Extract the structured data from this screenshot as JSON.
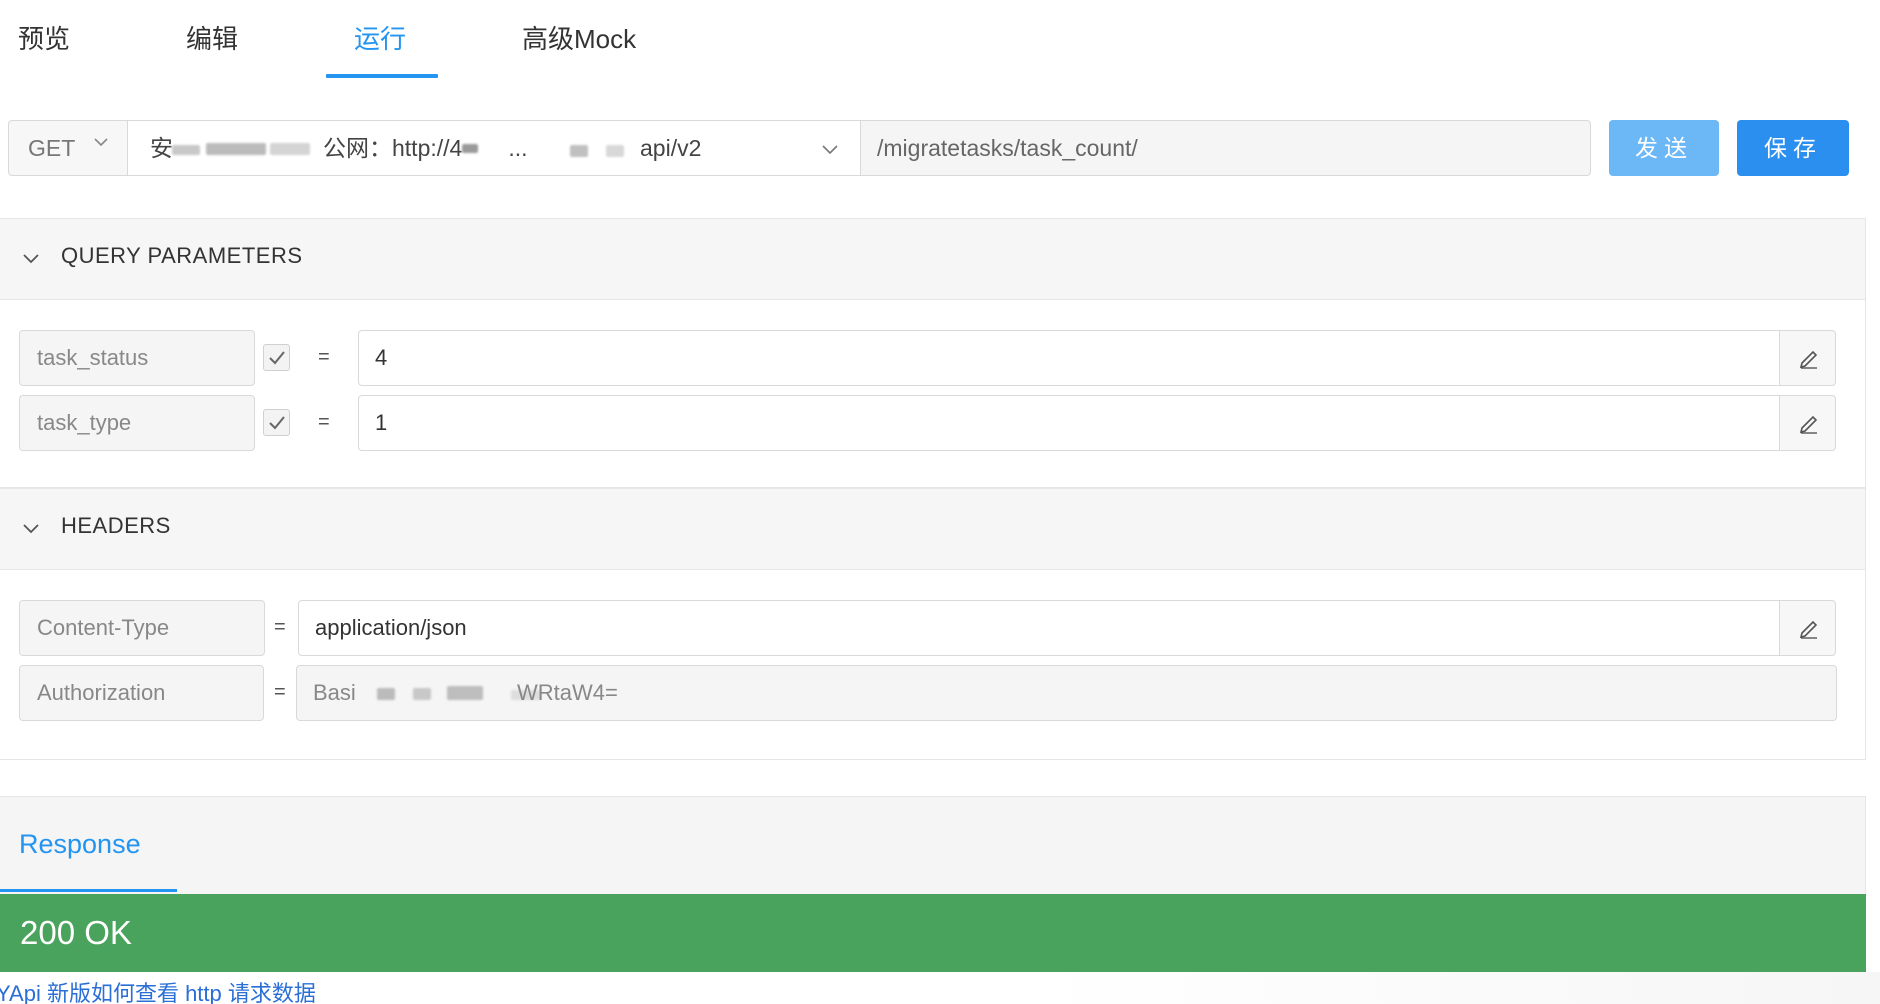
{
  "tabs": [
    {
      "label": "预览"
    },
    {
      "label": "编辑"
    },
    {
      "label": "运行"
    },
    {
      "label": "高级Mock"
    }
  ],
  "active_tab": "运行",
  "request": {
    "method": "GET",
    "env_prefix": "安",
    "env_middle": "公网：http://4",
    "env_ellipsis": "...",
    "env_suffix": "api/v2",
    "path": "/migratetasks/task_count/",
    "send_label": "发送",
    "save_label": "保存"
  },
  "query_section": {
    "title": "QUERY PARAMETERS",
    "params": [
      {
        "name": "task_status",
        "value": "4",
        "enabled": true
      },
      {
        "name": "task_type",
        "value": "1",
        "enabled": true
      }
    ]
  },
  "headers_section": {
    "title": "HEADERS",
    "headers": [
      {
        "name": "Content-Type",
        "value": "application/json",
        "editable": true
      },
      {
        "name": "Authorization",
        "value_start": "Basi",
        "value_end": "WRtaW4=",
        "editable": false
      }
    ]
  },
  "response": {
    "tab_label": "Response",
    "status": "200 OK"
  },
  "footer": {
    "link_text": "YApi 新版如何查看 http 请求数据"
  },
  "colors": {
    "accent": "#2395f1",
    "status_ok": "#4aa35c"
  },
  "equals": "="
}
